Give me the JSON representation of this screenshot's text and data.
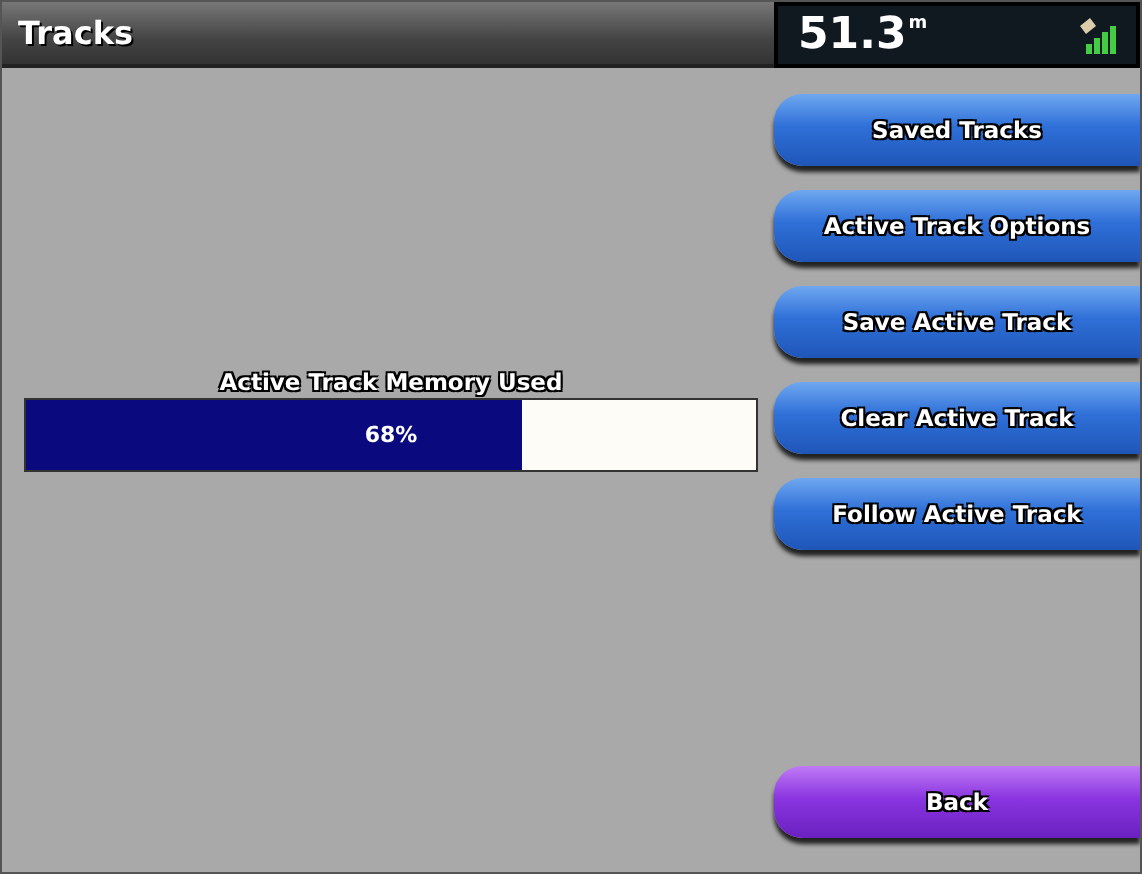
{
  "header": {
    "title": "Tracks",
    "reading": "51.3",
    "unit": "m"
  },
  "memory": {
    "label": "Active Track Memory Used",
    "level": 0.68,
    "reading": "68%"
  },
  "buttons": [
    {
      "label": "Saved Tracks",
      "kind": "menu"
    },
    {
      "label": "Active Track Options",
      "kind": "menu"
    },
    {
      "label": "Save Active Track",
      "kind": "menu"
    },
    {
      "label": "Clear Active Track",
      "kind": "menu"
    },
    {
      "label": "Follow Active Track",
      "kind": "menu"
    },
    {
      "label": "Back",
      "kind": "back"
    }
  ]
}
